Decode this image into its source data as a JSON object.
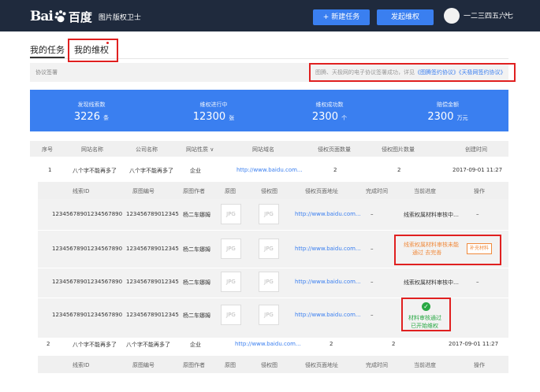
{
  "app": {
    "logo_bai": "Bai",
    "logo_du": "百度",
    "app_name": "图片版权卫士",
    "new_task": "+ 新建任务",
    "start_rights": "发起维权",
    "user_name": "一二三四五六七",
    "chevron": "›"
  },
  "tabs": {
    "my_tasks": "我的任务",
    "my_rights": "我的维权"
  },
  "agreement": {
    "title": "协议签署",
    "note_prefix": "图腾、天极网的电子协议签署成功，详见",
    "link1": "《图腾签约协议》",
    "link2": "《天极网签约协议》"
  },
  "stats": [
    {
      "label": "发现线索数",
      "value": "3226",
      "unit": "条"
    },
    {
      "label": "维权进行中",
      "value": "12300",
      "unit": "张"
    },
    {
      "label": "维权成功数",
      "value": "2300",
      "unit": "个"
    },
    {
      "label": "赔偿金额",
      "value": "2300",
      "unit": "万元"
    }
  ],
  "table": {
    "headers": [
      "序号",
      "网站名称",
      "公司名称",
      "网站性质",
      "网站域名",
      "侵权页面数量",
      "侵权图片数量",
      "创建时间"
    ],
    "sort_icon": "∨",
    "rows": [
      [
        "1",
        "八个字不能再多了",
        "八个字不能再多了",
        "企业",
        "http://www.baidu.com...",
        "2",
        "2",
        "2017-09-01 11:27"
      ],
      [
        "2",
        "八个字不能再多了",
        "八个字不能再多了",
        "企业",
        "http://www.baidu.com...",
        "2",
        "2",
        "2017-09-01 11:27"
      ]
    ]
  },
  "subtable": {
    "headers": [
      "线索ID",
      "原图编号",
      "原图作者",
      "原图",
      "侵权图",
      "侵权页面地址",
      "完成时间",
      "当前进度",
      "操作"
    ],
    "jpg": "JPG",
    "rows": [
      {
        "id": "12345678901234567890",
        "img_no": "123456789012345",
        "author": "杨二车娜姆",
        "url": "http://www.baidu.com...",
        "done": "–",
        "progress": "线索权属材料审核中…",
        "action": "–"
      },
      {
        "id": "12345678901234567890",
        "img_no": "123456789012345",
        "author": "杨二车娜姆",
        "url": "http://www.baidu.com...",
        "done": "–",
        "progress_line1": "线索权属材料审核未能",
        "progress_line2": "通过 去完善",
        "action": "补充材料"
      },
      {
        "id": "12345678901234567890",
        "img_no": "123456789012345",
        "author": "杨二车娜姆",
        "url": "http://www.baidu.com...",
        "done": "–",
        "progress": "线索权属材料审核中…",
        "action": "–"
      },
      {
        "id": "12345678901234567890",
        "img_no": "123456789012345",
        "author": "杨二车娜姆",
        "url": "http://www.baidu.com...",
        "done": "–",
        "progress_line1": "材料审核通过",
        "progress_line2": "已开始维权",
        "action": ""
      }
    ],
    "check": "✓"
  },
  "colors": {
    "nav_bg": "#1f2a3d",
    "accent": "#3a7ff0",
    "highlight": "#e02020",
    "warning": "#f08a3c",
    "success": "#29a844"
  }
}
